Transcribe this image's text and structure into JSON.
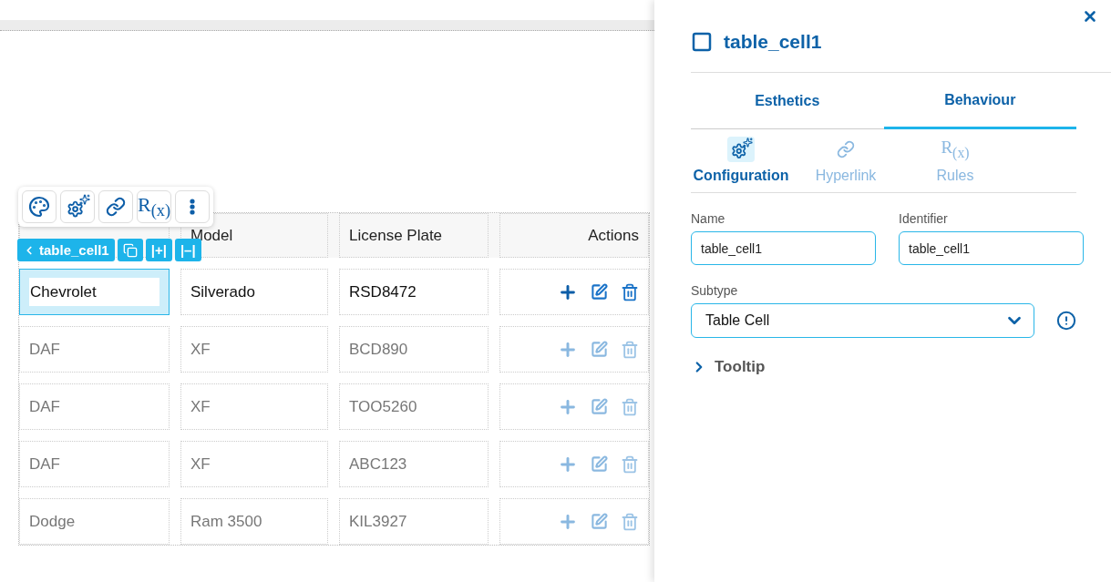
{
  "canvas": {
    "toolbar": {
      "rules_label": "R$_{(x)}$"
    },
    "selection": {
      "label": "table_cell1",
      "add_column": "|+|",
      "remove_column": "|–|"
    },
    "table": {
      "columns": [
        "",
        "Model",
        "License Plate",
        "Actions"
      ],
      "rows": [
        {
          "active": true,
          "cells": [
            {
              "text": "Chevrolet",
              "selected": true
            },
            {
              "text": "Silverado",
              "selected": false
            },
            {
              "text": "RSD8472",
              "selected": false
            }
          ]
        },
        {
          "active": false,
          "cells": [
            {
              "text": "DAF",
              "selected": false
            },
            {
              "text": "XF",
              "selected": false
            },
            {
              "text": "BCD890",
              "selected": false
            }
          ]
        },
        {
          "active": false,
          "cells": [
            {
              "text": "DAF",
              "selected": false
            },
            {
              "text": "XF",
              "selected": false
            },
            {
              "text": "TOO5260",
              "selected": false
            }
          ]
        },
        {
          "active": false,
          "cells": [
            {
              "text": "DAF",
              "selected": false
            },
            {
              "text": "XF",
              "selected": false
            },
            {
              "text": "ABC123",
              "selected": false
            }
          ]
        },
        {
          "active": false,
          "cells": [
            {
              "text": "Dodge",
              "selected": false
            },
            {
              "text": "Ram 3500",
              "selected": false
            },
            {
              "text": "KIL3927",
              "selected": false
            }
          ]
        }
      ]
    }
  },
  "panel": {
    "title": "table_cell1",
    "tabs": [
      {
        "label": "Esthetics",
        "selected": false
      },
      {
        "label": "Behaviour",
        "selected": true
      }
    ],
    "subtabs": [
      {
        "kind": "configuration",
        "label": "Configuration",
        "selected": true
      },
      {
        "kind": "hyperlink",
        "label": "Hyperlink",
        "selected": false
      },
      {
        "kind": "rules",
        "label": "Rules",
        "icon_text": "R$_{(x)}$",
        "selected": false
      }
    ],
    "fields": [
      {
        "label": "Name",
        "value": "table_cell1"
      },
      {
        "label": "Identifier",
        "value": "table_cell1"
      }
    ],
    "subtype": {
      "label": "Subtype",
      "value": "Table Cell"
    },
    "tooltip": {
      "label": "Tooltip",
      "expanded": false
    }
  }
}
